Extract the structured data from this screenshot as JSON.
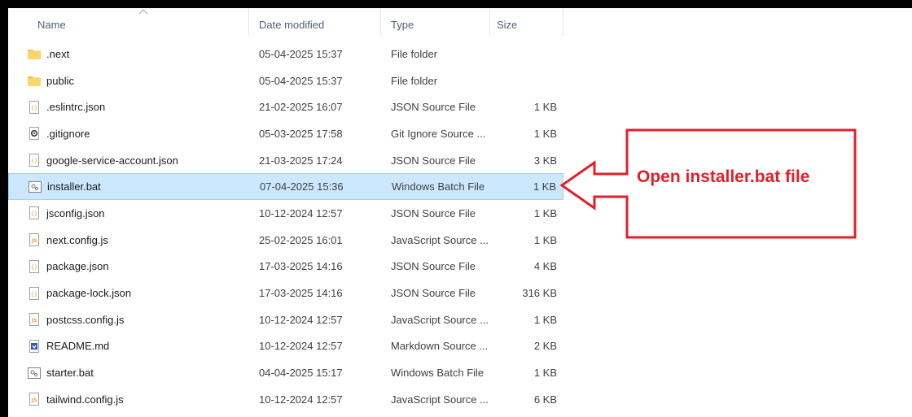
{
  "columns": {
    "name": "Name",
    "date_modified": "Date modified",
    "type": "Type",
    "size": "Size"
  },
  "files": [
    {
      "name": ".next",
      "date": "05-04-2025 15:37",
      "type": "File folder",
      "size": "",
      "icon": "folder-icon"
    },
    {
      "name": "public",
      "date": "05-04-2025 15:37",
      "type": "File folder",
      "size": "",
      "icon": "folder-icon"
    },
    {
      "name": ".eslintrc.json",
      "date": "21-02-2025 16:07",
      "type": "JSON Source File",
      "size": "1 KB",
      "icon": "json-file-icon"
    },
    {
      "name": ".gitignore",
      "date": "05-03-2025 17:58",
      "type": "Git Ignore Source ...",
      "size": "1 KB",
      "icon": "settings-file-icon"
    },
    {
      "name": "google-service-account.json",
      "date": "21-03-2025 17:24",
      "type": "JSON Source File",
      "size": "3 KB",
      "icon": "json-file-icon"
    },
    {
      "name": "installer.bat",
      "date": "07-04-2025 15:36",
      "type": "Windows Batch File",
      "size": "1 KB",
      "icon": "batch-file-icon",
      "selected": true
    },
    {
      "name": "jsconfig.json",
      "date": "10-12-2024 12:57",
      "type": "JSON Source File",
      "size": "1 KB",
      "icon": "json-file-icon"
    },
    {
      "name": "next.config.js",
      "date": "25-02-2025 16:01",
      "type": "JavaScript Source ...",
      "size": "1 KB",
      "icon": "js-file-icon"
    },
    {
      "name": "package.json",
      "date": "17-03-2025 14:16",
      "type": "JSON Source File",
      "size": "4 KB",
      "icon": "json-file-icon"
    },
    {
      "name": "package-lock.json",
      "date": "17-03-2025 14:16",
      "type": "JSON Source File",
      "size": "316 KB",
      "icon": "json-file-icon"
    },
    {
      "name": "postcss.config.js",
      "date": "10-12-2024 12:57",
      "type": "JavaScript Source ...",
      "size": "1 KB",
      "icon": "js-file-icon"
    },
    {
      "name": "README.md",
      "date": "10-12-2024 12:57",
      "type": "Markdown Source ...",
      "size": "2 KB",
      "icon": "markdown-file-icon"
    },
    {
      "name": "starter.bat",
      "date": "04-04-2025 15:17",
      "type": "Windows Batch File",
      "size": "1 KB",
      "icon": "batch-file-icon"
    },
    {
      "name": "tailwind.config.js",
      "date": "10-12-2024 12:57",
      "type": "JavaScript Source ...",
      "size": "6 KB",
      "icon": "js-file-icon"
    }
  ],
  "annotation": {
    "text": "Open installer.bat file",
    "color": "#e0202a"
  },
  "colors": {
    "selection_bg": "#cce8ff",
    "selection_border": "#99d1ff",
    "folder": "#f4c542",
    "json_icon": "#e8a33b",
    "js_icon": "#e8a33b"
  }
}
